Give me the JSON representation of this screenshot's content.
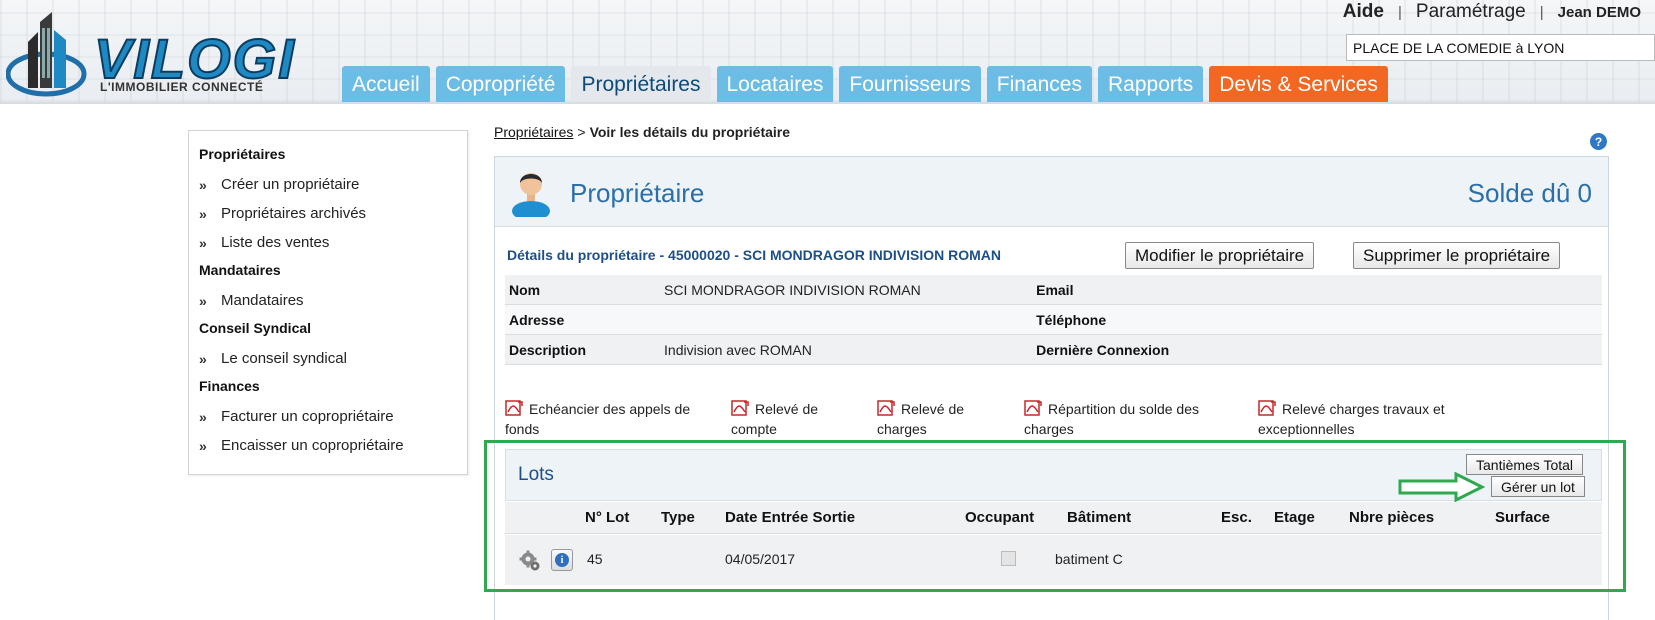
{
  "brand": {
    "name": "VILOGI",
    "tagline": "L'IMMOBILIER CONNECTÉ"
  },
  "top_links": {
    "aide": "Aide",
    "parametrage": "Paramétrage",
    "user": "Jean DEMO",
    "separator": "|"
  },
  "residence": {
    "value": "PLACE DE LA COMEDIE à LYON"
  },
  "nav": {
    "tabs": [
      {
        "label": "Accueil"
      },
      {
        "label": "Copropriété"
      },
      {
        "label": "Propriétaires"
      },
      {
        "label": "Locataires"
      },
      {
        "label": "Fournisseurs"
      },
      {
        "label": "Finances"
      },
      {
        "label": "Rapports"
      },
      {
        "label": "Devis & Services"
      }
    ]
  },
  "sidebar": {
    "sections": [
      {
        "title": "Propriétaires",
        "items": [
          "Créer un propriétaire",
          "Propriétaires archivés",
          "Liste des ventes"
        ]
      },
      {
        "title": "Mandataires",
        "items": [
          "Mandataires"
        ]
      },
      {
        "title": "Conseil Syndical",
        "items": [
          "Le conseil syndical"
        ]
      },
      {
        "title": "Finances",
        "items": [
          "Facturer un copropriétaire",
          "Encaisser un copropriétaire"
        ]
      }
    ],
    "chevron": "»"
  },
  "breadcrumb": {
    "link": "Propriétaires",
    "separator": ">",
    "current": "Voir les détails du propriétaire"
  },
  "help": "?",
  "panel": {
    "title": "Propriétaire",
    "solde": "Solde dû 0"
  },
  "details": {
    "title": "Détails du propriétaire - 45000020 - SCI MONDRAGOR INDIVISION ROMAN",
    "modify_label": "Modifier le propriétaire",
    "delete_label": "Supprimer le propriétaire",
    "rows": [
      {
        "label": "Nom",
        "value": "SCI MONDRAGOR INDIVISION ROMAN",
        "label2": "Email",
        "value2": ""
      },
      {
        "label": "Adresse",
        "value": "",
        "label2": "Téléphone",
        "value2": ""
      },
      {
        "label": "Description",
        "value": "Indivision avec ROMAN",
        "label2": "Dernière Connexion",
        "value2": ""
      }
    ]
  },
  "reports": [
    {
      "line1": "Echéancier des appels de",
      "line2": "fonds"
    },
    {
      "line1": "Relevé de",
      "line2": "compte"
    },
    {
      "line1": "Relevé de",
      "line2": "charges"
    },
    {
      "line1": "Répartition du solde des",
      "line2": "charges"
    },
    {
      "line1": "Relevé charges travaux et",
      "line2": "exceptionnelles"
    }
  ],
  "lots": {
    "title": "Lots",
    "tantiemes_label": "Tantièmes Total",
    "gerer_label": "Gérer un lot",
    "columns": [
      "N° Lot",
      "Type",
      "Date Entrée Sortie",
      "Occupant",
      "Bâtiment",
      "Esc.",
      "Etage",
      "Nbre pièces",
      "Surface"
    ],
    "rows": [
      {
        "num": "45",
        "type": "",
        "date": "04/05/2017",
        "occupant": false,
        "batiment": "batiment C",
        "esc": "",
        "etage": "",
        "pieces": "",
        "surface": ""
      }
    ]
  },
  "colors": {
    "tab": "#6cbde6",
    "tab_active": "#e4e8ec",
    "devis": "#f26722",
    "highlight": "#2fa84f",
    "title_blue": "#2b6fa6"
  }
}
